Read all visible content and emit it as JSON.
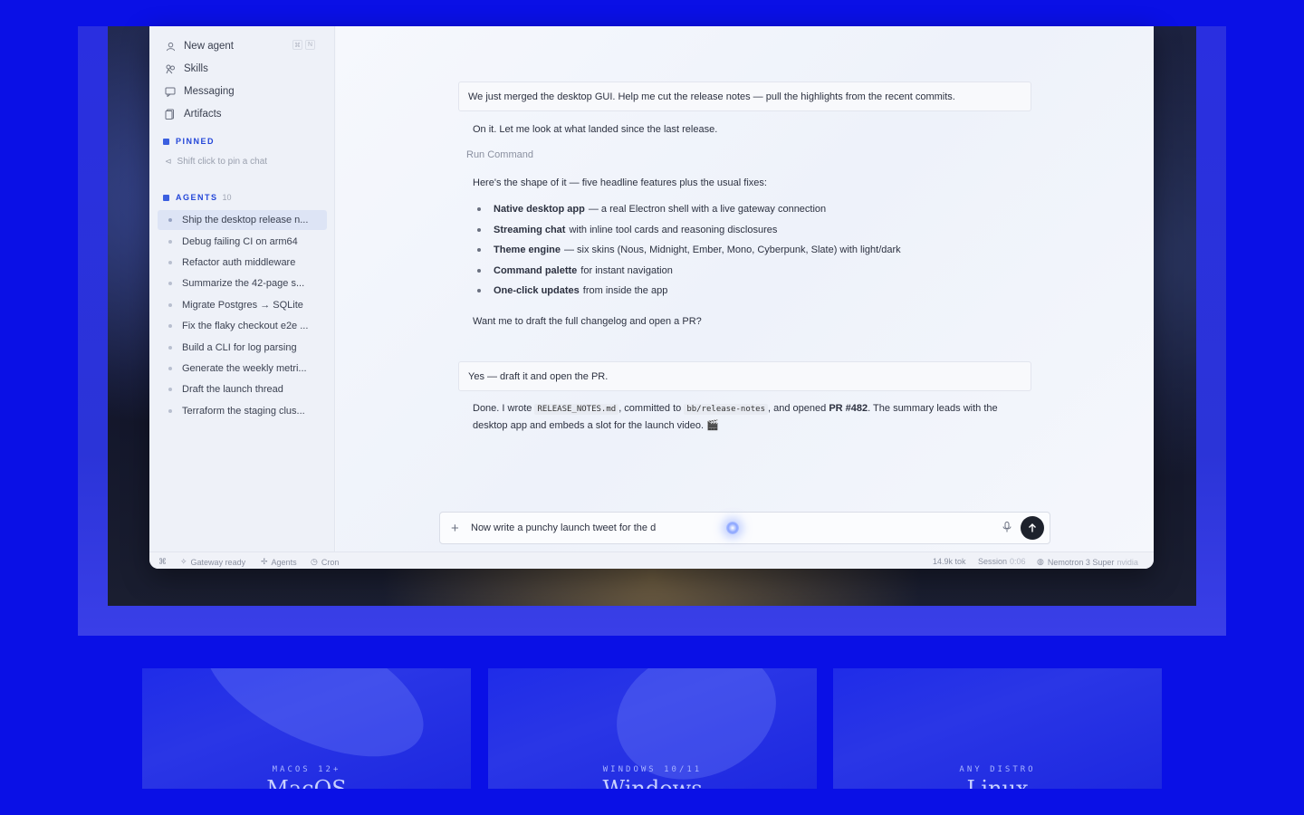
{
  "sidebar": {
    "nav": [
      {
        "label": "New agent",
        "icon": "user-icon"
      },
      {
        "label": "Skills",
        "icon": "skills-icon"
      },
      {
        "label": "Messaging",
        "icon": "chat-icon"
      },
      {
        "label": "Artifacts",
        "icon": "document-icon"
      }
    ],
    "pinned_title": "PINNED",
    "pin_hint": "Shift click to pin a chat",
    "agents_title": "AGENTS",
    "agents_count": "10",
    "agents": [
      "Ship the desktop release n...",
      "Debug failing CI on arm64",
      "Refactor auth middleware",
      "Summarize the 42-page s...",
      "Migrate Postgres → SQLite",
      "Fix the flaky checkout e2e ...",
      "Build a CLI for log parsing",
      "Generate the weekly metri...",
      "Draft the launch thread",
      "Terraform the staging clus..."
    ]
  },
  "chat": {
    "user_msg_1": "We just merged the desktop GUI. Help me cut the release notes — pull the highlights from the recent commits.",
    "assistant_1": "On it. Let me look at what landed since the last release.",
    "run_command": "Run Command",
    "assistant_2": "Here's the shape of it — five headline features plus the usual fixes:",
    "features": [
      {
        "bold": "Native desktop app",
        "rest": "— a real Electron shell with a live gateway connection"
      },
      {
        "bold": "Streaming chat",
        "rest": "with inline tool cards and reasoning disclosures"
      },
      {
        "bold": "Theme engine",
        "rest": "— six skins (Nous, Midnight, Ember, Mono, Cyberpunk, Slate) with light/dark"
      },
      {
        "bold": "Command palette",
        "rest": "for instant navigation"
      },
      {
        "bold": "One-click updates",
        "rest": "from inside the app"
      }
    ],
    "assistant_3": "Want me to draft the full changelog and open a PR?",
    "user_msg_2": "Yes — draft it and open the PR.",
    "final": {
      "p1": "Done. I wrote",
      "code1": "RELEASE_NOTES.md",
      "p2": ", committed to",
      "code2": "bb/release-notes",
      "p3": ", and opened",
      "pr": "PR #482",
      "p4": ". The summary leads with the",
      "line2": "desktop app and embeds a slot for the launch video. 🎬"
    }
  },
  "composer": {
    "value": "Now write a punchy launch tweet for the d"
  },
  "statusbar": {
    "gateway": "Gateway ready",
    "agents": "Agents",
    "cron": "Cron",
    "tokens": "14.9k tok",
    "session_label": "Session",
    "session_value": "0:06",
    "model": "Nemotron 3 Super",
    "provider": "nvidia"
  },
  "platforms": [
    {
      "label": "MACOS 12+",
      "big": "MacOS"
    },
    {
      "label": "WINDOWS 10/11",
      "big": "Windows"
    },
    {
      "label": "ANY DISTRO",
      "big": "Linux"
    }
  ],
  "colors": {
    "page_bg": "#0a10e6",
    "accent": "#2346d8",
    "send_button": "#1e222c"
  }
}
